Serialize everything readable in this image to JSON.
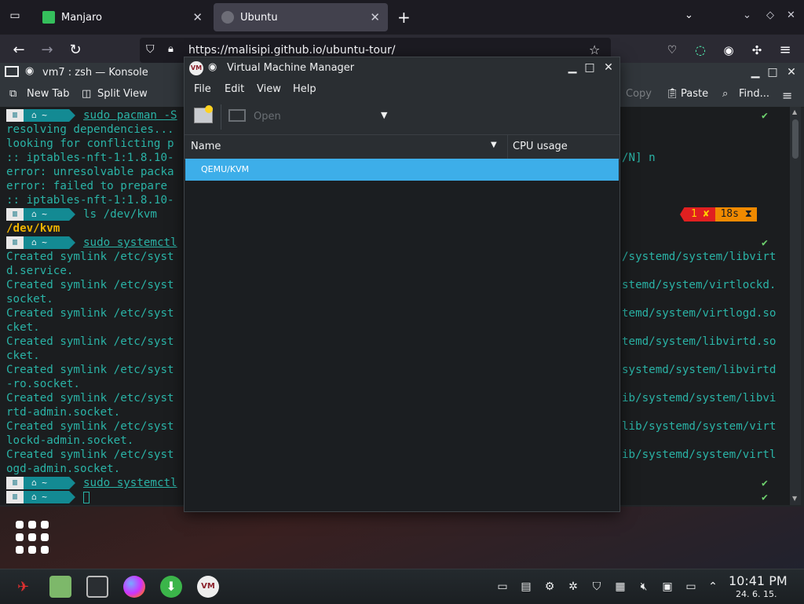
{
  "browser": {
    "tabs": [
      {
        "title": "Manjaro"
      },
      {
        "title": "Ubuntu"
      }
    ],
    "url": "https://malisipi.github.io/ubuntu-tour/"
  },
  "konsole": {
    "title": "vm7 : zsh — Konsole",
    "toolbar": {
      "new_tab": "New Tab",
      "split_view": "Split View",
      "copy": "Copy",
      "paste": "Paste",
      "find": "Find..."
    },
    "lines": [
      {
        "left": "resolving dependencies...",
        "right": ""
      },
      {
        "left": "looking for conflicting p",
        "right": "/N] n"
      },
      {
        "left": ":: iptables-nft-1:1.8.10-",
        "right": ""
      },
      {
        "left": "error: unresolvable packa",
        "right": ""
      },
      {
        "left": "error: failed to prepare",
        "right": ""
      },
      {
        "left": ":: iptables-nft-1:1.8.10-",
        "right": ""
      }
    ],
    "prompt1_cmd": "sudo pacman -S",
    "prompt2_cmd": "ls /dev/kvm",
    "prompt2_out": "/dev/kvm",
    "status_error": "1 ✘",
    "status_time": "18s ⧗",
    "prompt3_cmd": "sudo systemctl",
    "symlinks": [
      {
        "left": "Created symlink /etc/syst",
        "right": "/systemd/system/libvirt",
        "cont": "d.service."
      },
      {
        "left": "Created symlink /etc/syst",
        "right": "stemd/system/virtlockd.",
        "cont": "socket."
      },
      {
        "left": "Created symlink /etc/syst",
        "right": "temd/system/virtlogd.so",
        "cont": "cket."
      },
      {
        "left": "Created symlink /etc/syst",
        "right": "temd/system/libvirtd.so",
        "cont": "cket."
      },
      {
        "left": "Created symlink /etc/syst",
        "right": "systemd/system/libvirtd",
        "cont": "-ro.socket."
      },
      {
        "left": "Created symlink /etc/syst",
        "right": "ib/systemd/system/libvi",
        "cont": "rtd-admin.socket."
      },
      {
        "left": "Created symlink /etc/syst",
        "right": "lib/systemd/system/virt",
        "cont": "lockd-admin.socket."
      },
      {
        "left": "Created symlink /etc/syst",
        "right": "ib/systemd/system/virtl",
        "cont": "ogd-admin.socket."
      }
    ],
    "prompt4_cmd": "sudo systemctl",
    "prompt_home": "⌂ ~"
  },
  "vmm": {
    "title": "Virtual Machine Manager",
    "menu": [
      "File",
      "Edit",
      "View",
      "Help"
    ],
    "open_label": "Open",
    "columns": {
      "name": "Name",
      "cpu": "CPU usage"
    },
    "connection": "QEMU/KVM"
  },
  "taskbar": {
    "time": "10:41 PM",
    "date": "24. 6. 15."
  },
  "colors": {
    "accent": "#3daee9",
    "terminal_text": "#2ab3a6",
    "error_badge": "#e02020",
    "time_badge": "#f08a00"
  }
}
